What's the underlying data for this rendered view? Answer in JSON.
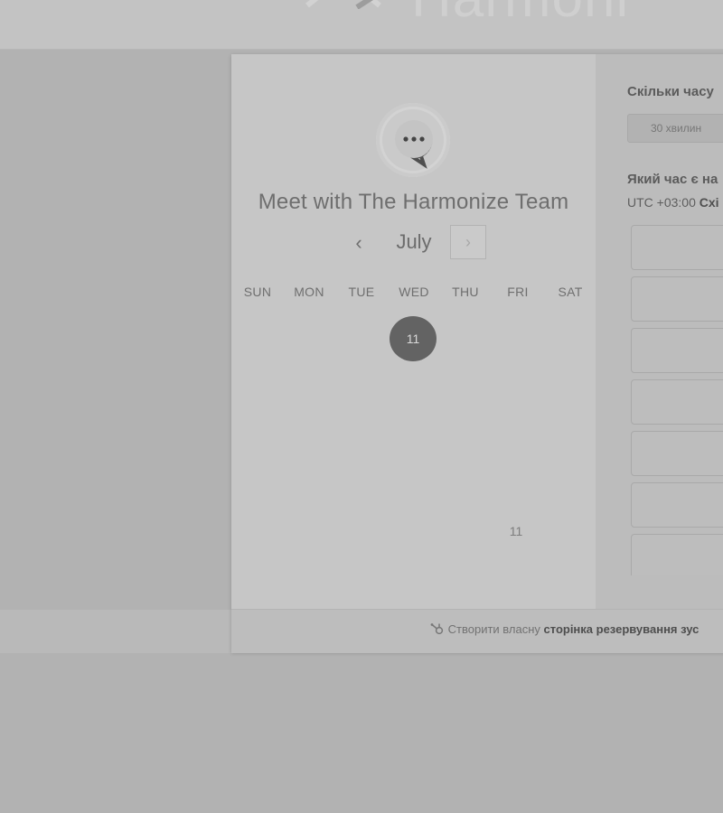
{
  "site": {
    "brand_text": "Harmoni",
    "brand_icon": "harmonize-logo-icon"
  },
  "calendar": {
    "avatar_icon": "chat-bubble-icon",
    "meeting_title": "Meet with The Harmonize Team",
    "prev_label": "‹",
    "month": "July",
    "next_label": "›",
    "weekdays": [
      "SUN",
      "MON",
      "TUE",
      "WED",
      "THU",
      "FRI",
      "SAT"
    ],
    "selected_day": "11",
    "footer_day": "11"
  },
  "booking": {
    "duration_heading": "Скільки часу",
    "duration_option": "30 хвилин",
    "time_heading": "Який час є на",
    "timezone_prefix": "UTC +03:00",
    "timezone_name": "Схі",
    "slot_count": 7
  },
  "footer": {
    "icon": "hubspot-sprocket-icon",
    "text": "Створити власну",
    "link_text": "сторінка резервування зус"
  },
  "colors": {
    "overlay_bg": "#b2b2b2",
    "panel_bg": "#c6c6c6",
    "selected_day_bg": "#636363"
  }
}
